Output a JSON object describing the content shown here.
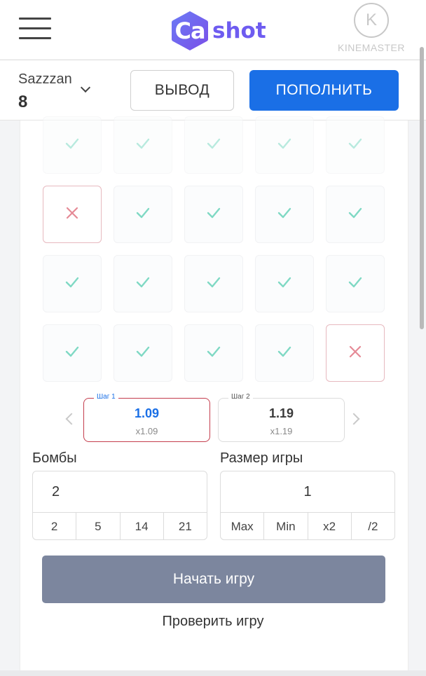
{
  "header": {
    "logo_mark": "Ca",
    "logo_text": "shot",
    "watermark_text": "KINEMASTER",
    "watermark_icon": "K"
  },
  "account": {
    "username": "Sazzzan",
    "balance": "8",
    "withdraw_label": "ВЫВОД",
    "deposit_label": "ПОПОЛНИТЬ"
  },
  "grid": {
    "rows": [
      [
        "check",
        "check",
        "check",
        "check",
        "check"
      ],
      [
        "bomb",
        "check",
        "check",
        "check",
        "check"
      ],
      [
        "check",
        "check",
        "check",
        "check",
        "check"
      ],
      [
        "check",
        "check",
        "check",
        "check",
        "bomb"
      ]
    ]
  },
  "steps": [
    {
      "label": "Шаг 1",
      "value": "1.09",
      "multiplier": "x1.09",
      "active": true
    },
    {
      "label": "Шаг 2",
      "value": "1.19",
      "multiplier": "x1.19",
      "active": false
    }
  ],
  "bombs": {
    "label": "Бомбы",
    "value": "2",
    "options": [
      "2",
      "5",
      "14",
      "21"
    ]
  },
  "game_size": {
    "label": "Размер игры",
    "value": "1",
    "options": [
      "Max",
      "Min",
      "x2",
      "/2"
    ]
  },
  "start_button_label": "Начать игру",
  "check_game_label": "Проверить игру",
  "colors": {
    "accent_blue": "#1a6fe6",
    "logo_purple": "#6e5cf0",
    "check_green": "#7fd9c4",
    "bomb_red": "#e58a96",
    "start_button": "#7c869e"
  }
}
